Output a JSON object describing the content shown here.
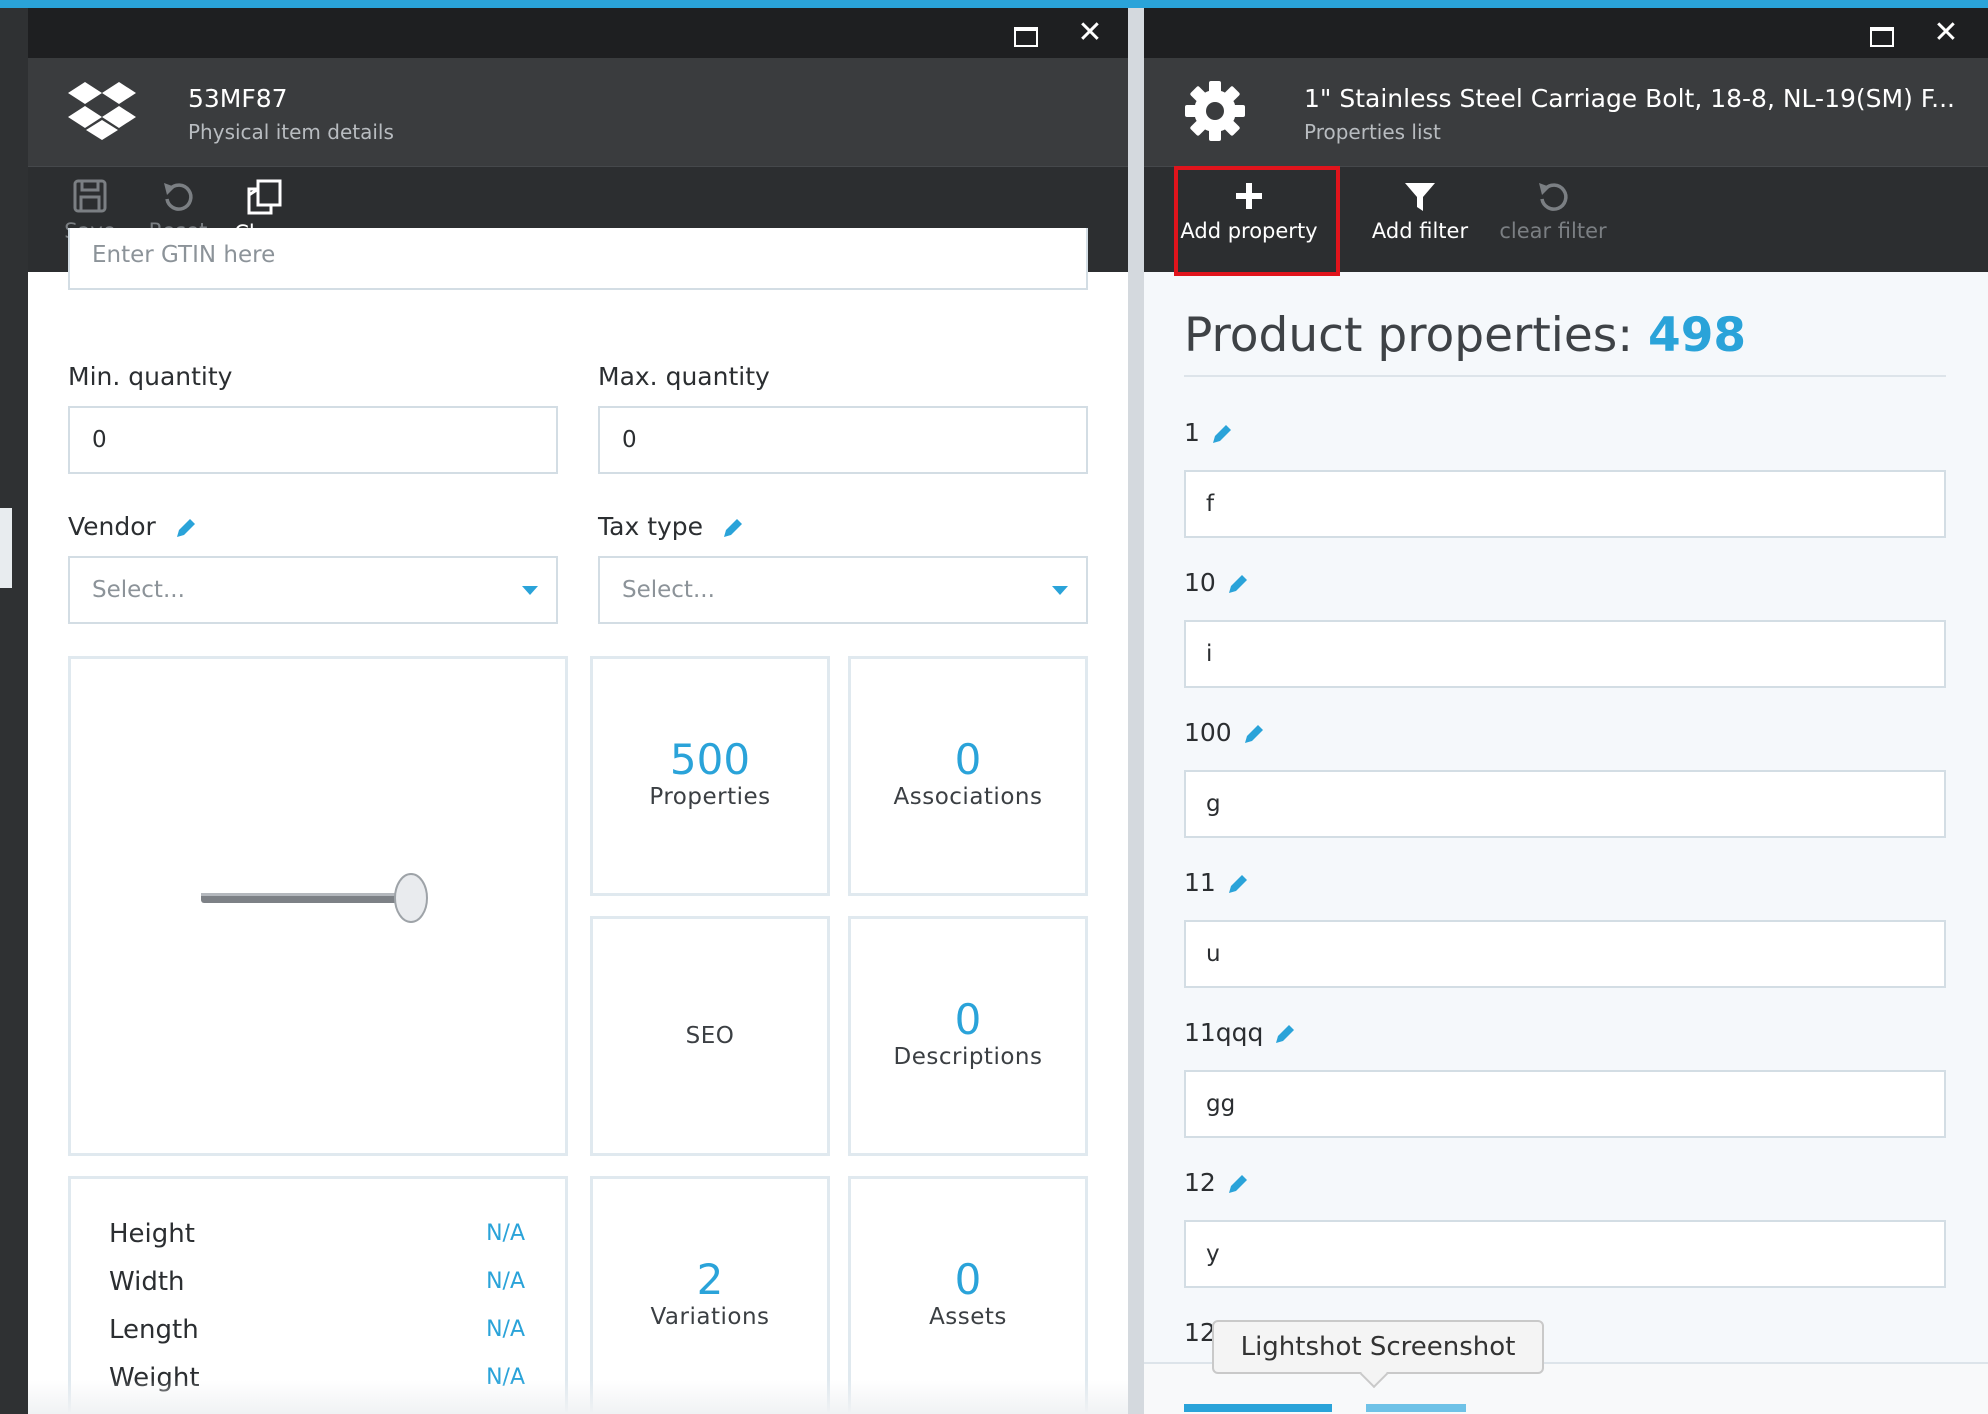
{
  "left_blade": {
    "title": "53MF87",
    "subtitle": "Physical item details",
    "toolbar": {
      "save": "Save",
      "reset": "Reset",
      "clone": "Clone"
    },
    "gtin_placeholder": "Enter GTIN here",
    "min_quantity": {
      "label": "Min. quantity",
      "value": "0"
    },
    "max_quantity": {
      "label": "Max. quantity",
      "value": "0"
    },
    "vendor": {
      "label": "Vendor",
      "placeholder": "Select..."
    },
    "tax_type": {
      "label": "Tax type",
      "placeholder": "Select..."
    },
    "tiles": {
      "properties": {
        "count": "500",
        "label": "Properties"
      },
      "associations": {
        "count": "0",
        "label": "Associations"
      },
      "seo": {
        "label": "SEO"
      },
      "descriptions": {
        "count": "0",
        "label": "Descriptions"
      },
      "variations": {
        "count": "2",
        "label": "Variations"
      },
      "assets": {
        "count": "0",
        "label": "Assets"
      }
    },
    "dimensions": [
      {
        "label": "Height",
        "value": "N/A"
      },
      {
        "label": "Width",
        "value": "N/A"
      },
      {
        "label": "Length",
        "value": "N/A"
      },
      {
        "label": "Weight",
        "value": "N/A"
      }
    ]
  },
  "right_blade": {
    "title": "1\" Stainless Steel Carriage Bolt, 18-8, NL-19(SM) F...",
    "subtitle": "Properties list",
    "toolbar": {
      "add_property": "Add property",
      "add_filter": "Add filter",
      "clear_filter": "clear filter"
    },
    "heading": "Product properties: ",
    "count": "498",
    "properties": [
      {
        "name": "1",
        "value": "f"
      },
      {
        "name": "10",
        "value": "i"
      },
      {
        "name": "100",
        "value": "g"
      },
      {
        "name": "11",
        "value": "u"
      },
      {
        "name": "11qqq",
        "value": "gg"
      },
      {
        "name": "12",
        "value": "y"
      },
      {
        "name": "12"
      }
    ]
  },
  "tooltip": "Lightshot Screenshot",
  "colors": {
    "accent": "#2aa3d9",
    "highlight": "#e0141c",
    "header": "#3a3c3e",
    "toolbar": "#2c2e30"
  }
}
